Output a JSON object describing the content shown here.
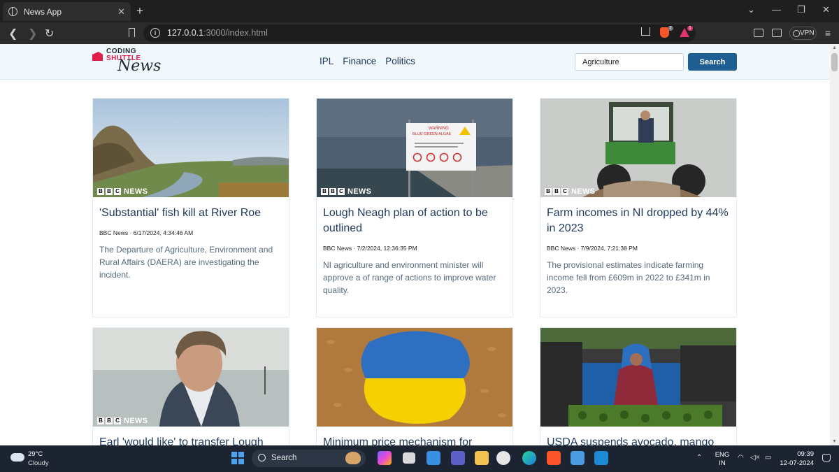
{
  "browser": {
    "tab_title": "News App",
    "url_host": "127.0.0.1",
    "url_rest": ":3000/index.html",
    "vpn_label": "VPN",
    "brave_badge": "2",
    "rewards_badge": "1"
  },
  "site": {
    "logo_line1": "CODING",
    "logo_line2": "SHUTTLE",
    "logo_script": "News",
    "nav": [
      "IPL",
      "Finance",
      "Politics"
    ],
    "search_value": "Agriculture",
    "search_button": "Search"
  },
  "source_badge": {
    "letters": [
      "B",
      "B",
      "C"
    ],
    "word": "NEWS"
  },
  "articles": [
    {
      "title": "'Substantial' fish kill at River Roe",
      "meta": "BBC News · 6/17/2024, 4:34:46 AM",
      "description": "The Departure of Agriculture, Environment and Rural Affairs (DAERA) are investigating the incident."
    },
    {
      "title": "Lough Neagh plan of action to be outlined",
      "meta": "BBC News · 7/2/2024, 12:36:35 PM",
      "description": "NI agriculture and environment minister will approve a of range of actions to improve water quality.",
      "image_sign": {
        "heading": "WARNING",
        "subheading": "BLUE-GREEN ALGAE"
      }
    },
    {
      "title": "Farm incomes in NI dropped by 44% in 2023",
      "meta": "BBC News · 7/9/2024, 7:21:38 PM",
      "description": "The provisional estimates indicate farming income fell from £609m in 2022 to £341m in 2023."
    },
    {
      "title": "Earl 'would like' to transfer Lough"
    },
    {
      "title": "Minimum price mechanism for"
    },
    {
      "title": "USDA suspends avocado, mango"
    }
  ],
  "taskbar": {
    "weather_temp": "29°C",
    "weather_condition": "Cloudy",
    "search_label": "Search",
    "lang_line1": "ENG",
    "lang_line2": "IN",
    "time": "09:39",
    "date": "12-07-2024"
  }
}
